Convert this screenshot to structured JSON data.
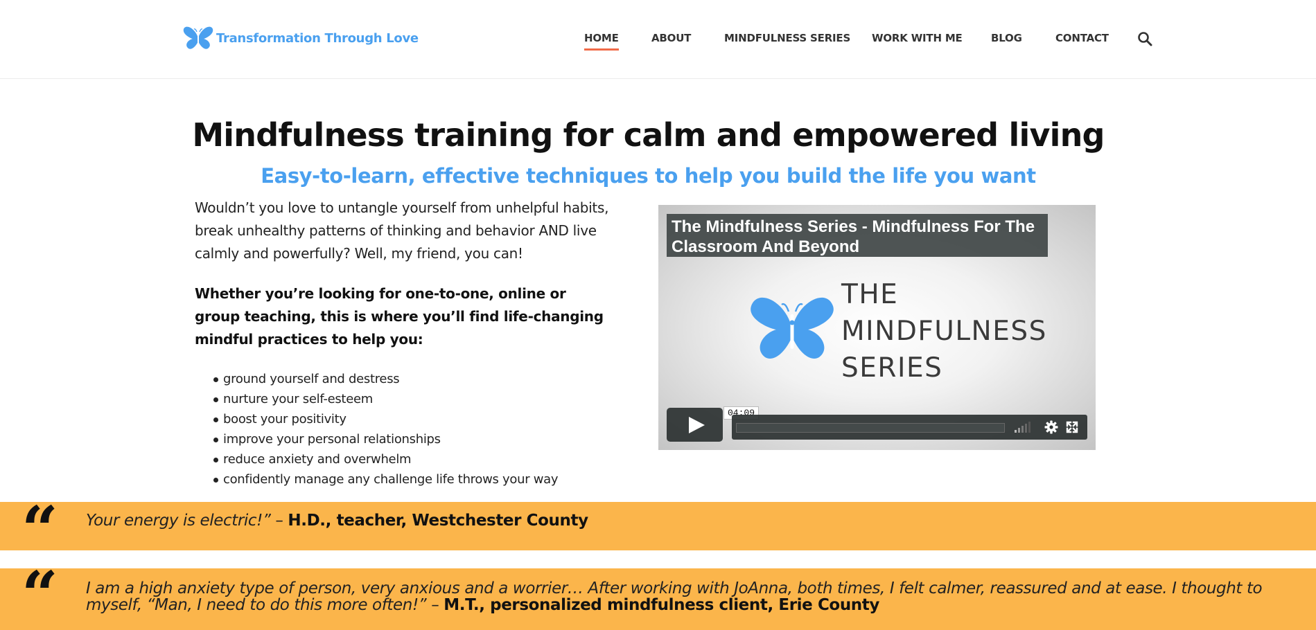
{
  "header": {
    "logo_text": "Transformation Through Love",
    "nav": [
      {
        "label": "HOME",
        "active": true
      },
      {
        "label": "ABOUT",
        "active": false
      },
      {
        "label": "MINDFULNESS SERIES",
        "active": false
      },
      {
        "label": "WORK WITH ME",
        "active": false
      },
      {
        "label": "BLOG",
        "active": false
      },
      {
        "label": "CONTACT",
        "active": false
      }
    ],
    "search_icon": "search-icon"
  },
  "hero": {
    "title": "Mindfulness training for calm and empowered living",
    "subtitle": "Easy-to-learn, effective techniques to help you build the life you want",
    "intro": "Wouldn’t you love to untangle yourself from unhelpful habits, break unhealthy patterns of thinking and behavior AND live calmly and powerfully? Well, my friend, you can!",
    "intro_bold": "Whether you’re looking for one-to-one, online or group teaching, this is where you’ll find life-changing mindful practices to help you:",
    "benefits": [
      "ground yourself and destress",
      "nurture your self-esteem",
      "boost your positivity",
      "improve your personal relationships",
      "reduce anxiety and overwhelm",
      "confidently manage any challenge life throws your way"
    ]
  },
  "video": {
    "title": "The Mindfulness Series - Mindfulness For The Classroom And Beyond",
    "brand_lines": [
      "THE",
      "MINDFULNESS",
      "SERIES"
    ],
    "duration": "04:09",
    "icons": [
      "play-icon",
      "volume-icon",
      "gear-icon",
      "fullscreen-icon"
    ]
  },
  "testimonials": [
    {
      "quote": "Your energy is electric!”",
      "separator": " – ",
      "author": "H.D., teacher, Westchester County"
    },
    {
      "quote": "I am a high anxiety type of person, very anxious and a worrier… After working with JoAnna, both times, I felt calmer, reassured and at ease. I thought to myself, “Man, I need to do this more often!”",
      "separator": " – ",
      "author": "M.T., personalized mindfulness client, Erie County"
    }
  ],
  "colors": {
    "brand_blue": "#4aa0ef",
    "nav_active_underline": "#f06a48",
    "testimonial_bg": "#fbb54b"
  },
  "quote_glyph": "“"
}
